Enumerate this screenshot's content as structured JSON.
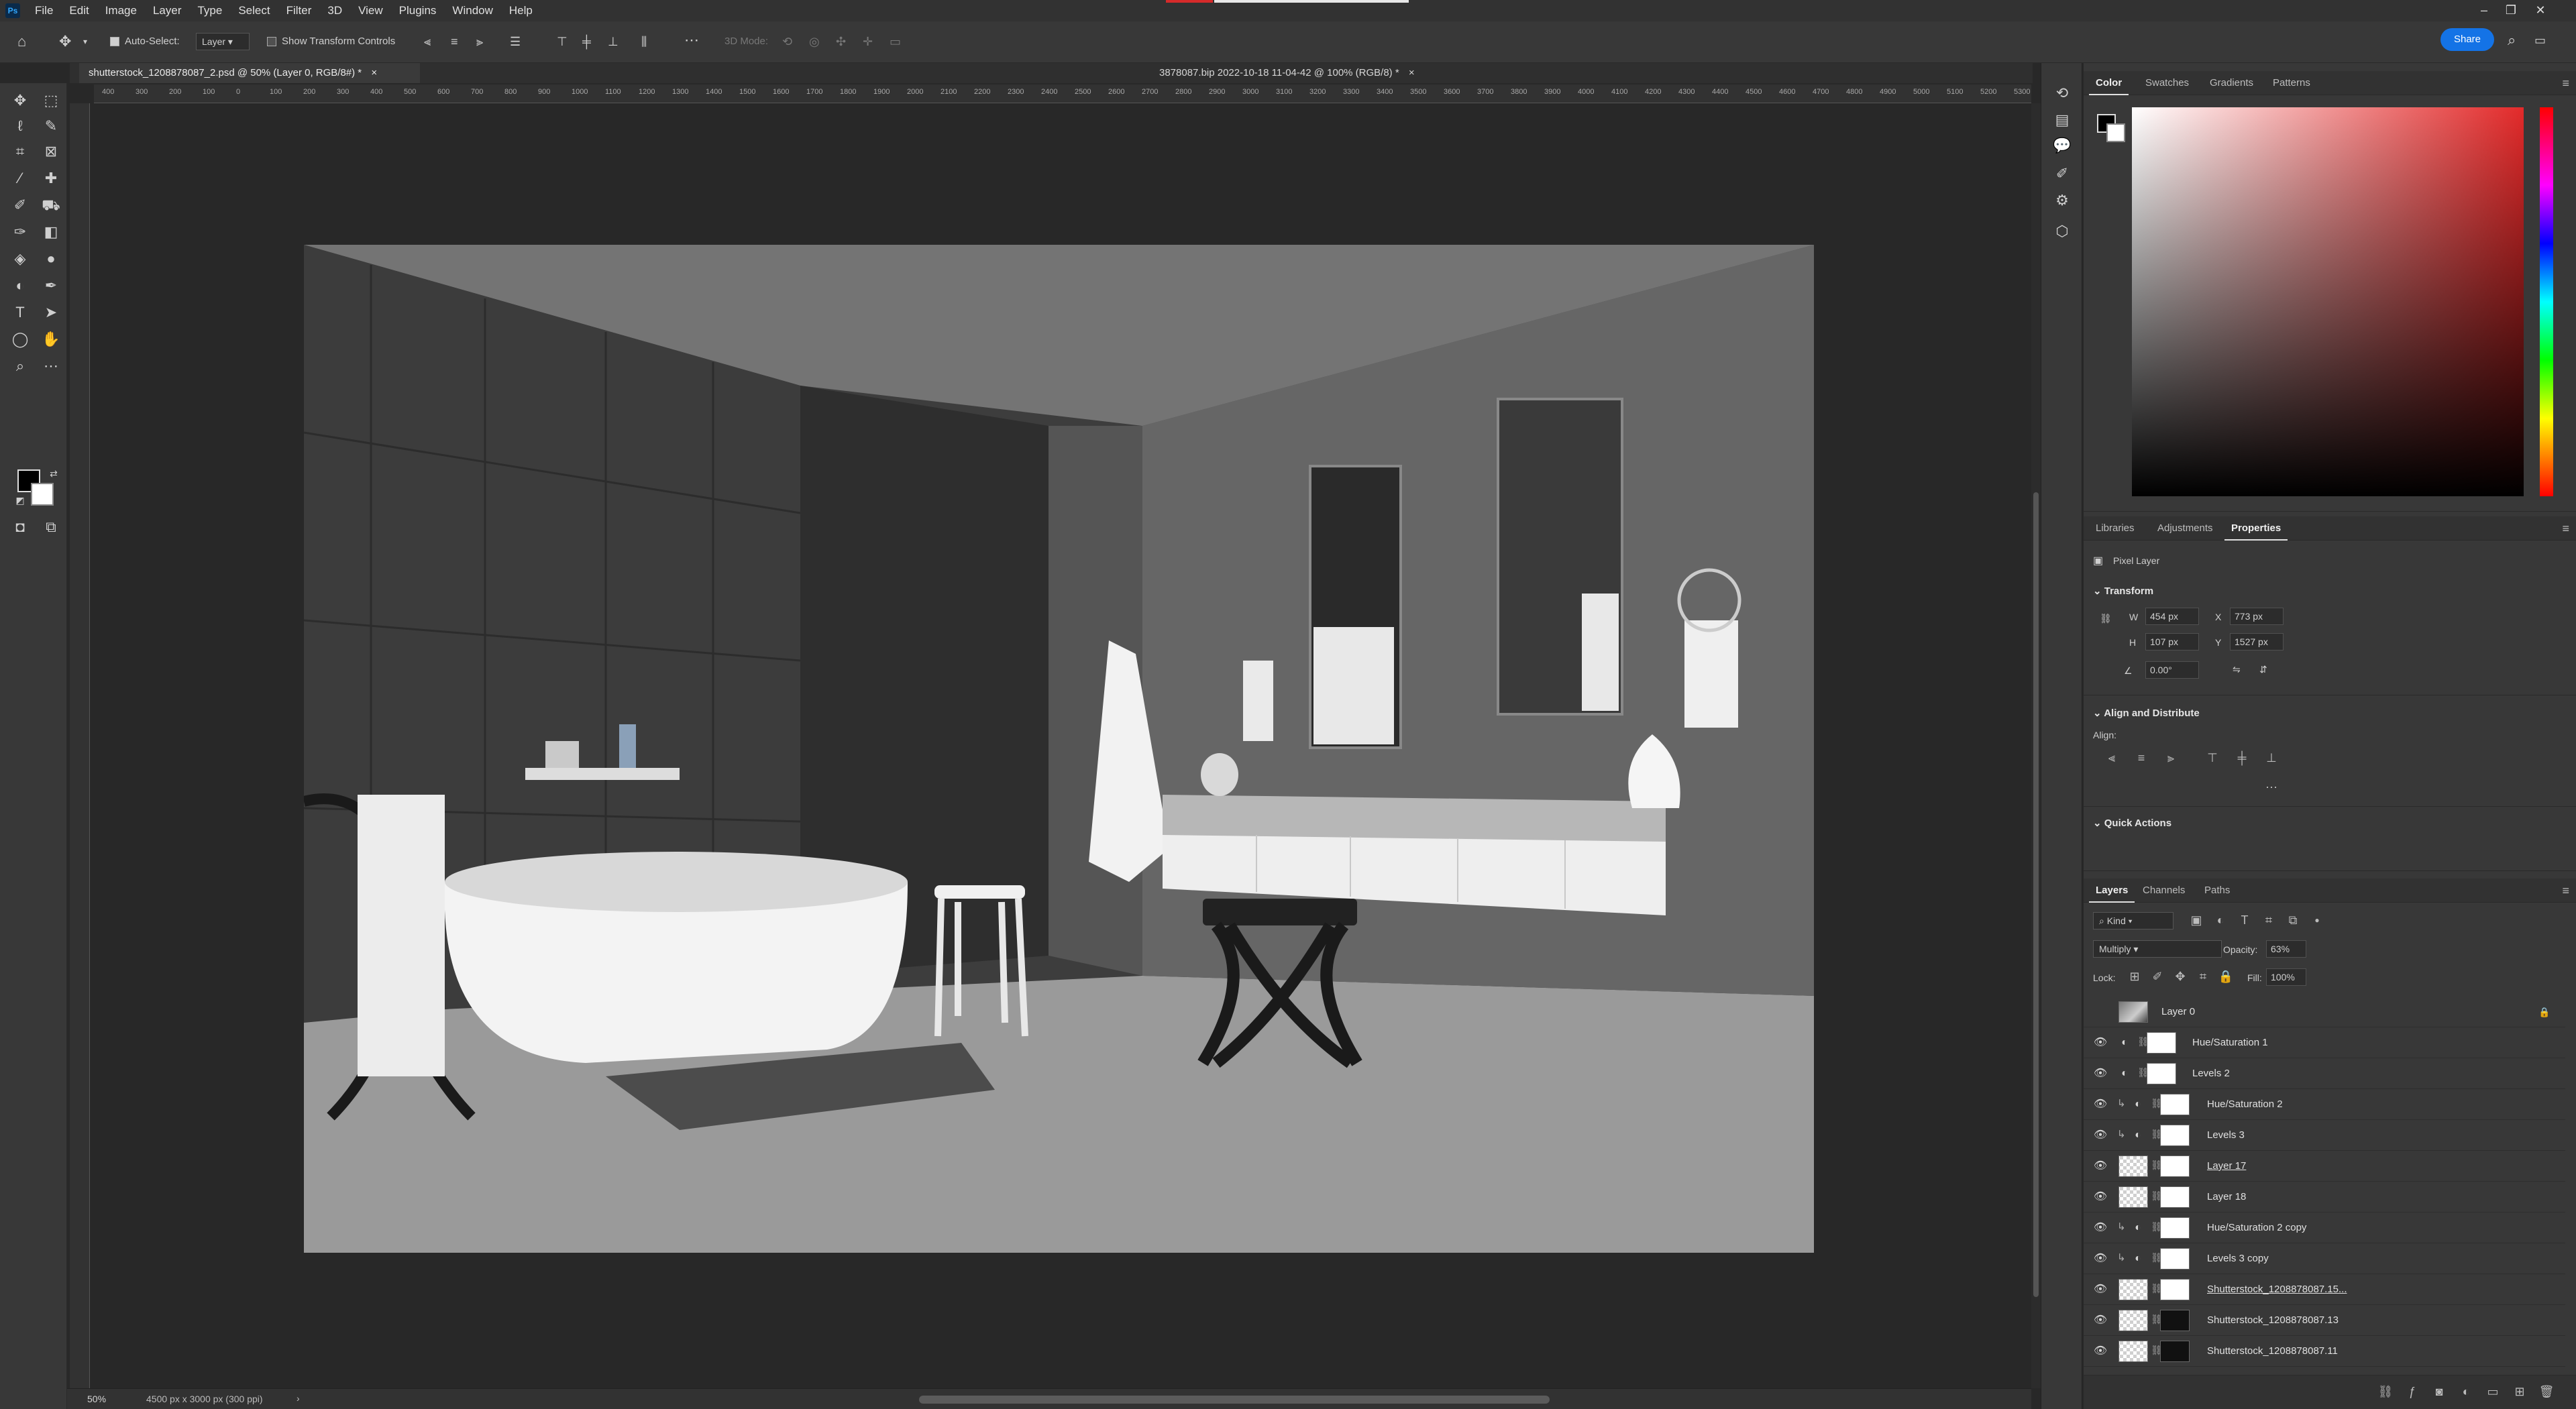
{
  "app": {
    "logo": "Ps",
    "menu": [
      "File",
      "Edit",
      "Image",
      "Layer",
      "Type",
      "Select",
      "Filter",
      "3D",
      "View",
      "Plugins",
      "Window",
      "Help"
    ]
  },
  "options": {
    "auto_select_label": "Auto-Select:",
    "auto_select_value": "Layer",
    "show_transform_label": "Show Transform Controls",
    "mode_3d_label": "3D Mode:",
    "share_label": "Share"
  },
  "tabs": {
    "doc1": "shutterstock_1208878087_2.psd @ 50% (Layer 0, RGB/8#) *",
    "doc2": "3878087.bip 2022-10-18 11-04-42 @ 100% (RGB/8) *"
  },
  "ruler": {
    "labels": [
      "400",
      "300",
      "200",
      "100",
      "0",
      "100",
      "200",
      "300",
      "400",
      "500",
      "600",
      "700",
      "800",
      "900",
      "1000",
      "1100",
      "1200",
      "1300",
      "1400",
      "1500",
      "1600",
      "1700",
      "1800",
      "1900",
      "2000",
      "2100",
      "2200",
      "2300",
      "2400",
      "2500",
      "2600",
      "2700",
      "2800",
      "2900",
      "3000",
      "3100",
      "3200",
      "3300",
      "3400",
      "3500",
      "3600",
      "3700",
      "3800",
      "3900",
      "4000",
      "4100",
      "4200",
      "4300",
      "4400",
      "4500",
      "4600",
      "4700",
      "4800",
      "4900",
      "5000",
      "5100",
      "5200",
      "5300"
    ]
  },
  "status": {
    "zoom": "50%",
    "doc_info": "4500 px x 3000 px (300 ppi)"
  },
  "color_panel": {
    "tabs": [
      "Color",
      "Swatches",
      "Gradients",
      "Patterns"
    ],
    "foreground": "#000000",
    "background": "#ffffff",
    "hue_color": "#e32a2a"
  },
  "properties_panel": {
    "tabs": [
      "Libraries",
      "Adjustments",
      "Properties"
    ],
    "layer_kind": "Pixel Layer",
    "transform_title": "Transform",
    "w_label": "W",
    "w_value": "454 px",
    "x_label": "X",
    "x_value": "773 px",
    "h_label": "H",
    "h_value": "107 px",
    "y_label": "Y",
    "y_value": "1527 px",
    "angle_value": "0.00°",
    "align_title": "Align and Distribute",
    "align_label": "Align:",
    "quick_actions_title": "Quick Actions"
  },
  "layers_panel": {
    "tabs": [
      "Layers",
      "Channels",
      "Paths"
    ],
    "filter_kind": "Kind",
    "blend_mode": "Multiply",
    "opacity_label": "Opacity:",
    "opacity_value": "63%",
    "lock_label": "Lock:",
    "fill_label": "Fill:",
    "fill_value": "100%",
    "layers": [
      {
        "name": "Layer 0"
      },
      {
        "name": "Hue/Saturation 1"
      },
      {
        "name": "Levels 2"
      },
      {
        "name": "Hue/Saturation 2"
      },
      {
        "name": "Levels 3"
      },
      {
        "name": "Layer 17"
      },
      {
        "name": "Layer 18"
      },
      {
        "name": "Hue/Saturation 2 copy"
      },
      {
        "name": "Levels 3 copy"
      },
      {
        "name": "Shutterstock_1208878087.15..."
      },
      {
        "name": "Shutterstock_1208878087.13"
      },
      {
        "name": "Shutterstock_1208878087.11"
      }
    ]
  }
}
